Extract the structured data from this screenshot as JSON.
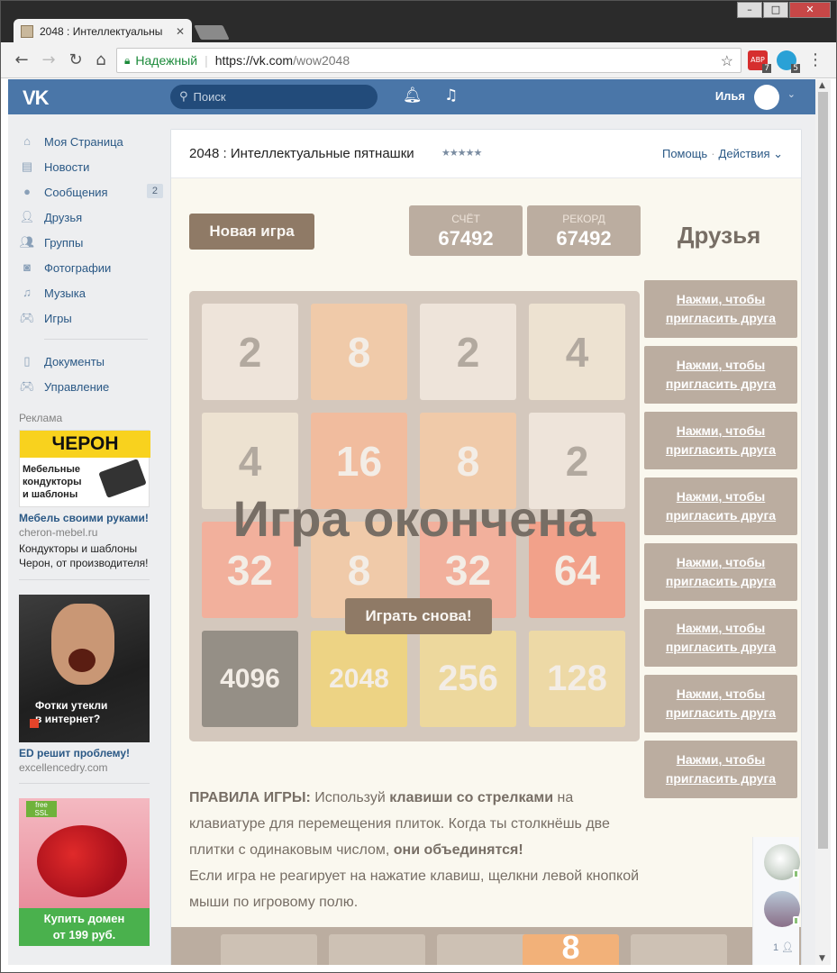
{
  "browser": {
    "tab_title": "2048 : Интеллектуальны",
    "tab_close": "✕",
    "secure_label": "Надежный",
    "url_host": "https://vk.com",
    "url_path": "/wow2048",
    "ext1_badge": "7",
    "ext2_badge": "5",
    "ext1_label": "ABP",
    "window_buttons": {
      "minimize": "–",
      "maximize": "□",
      "close": "✕"
    }
  },
  "vk": {
    "logo": "VK",
    "search_placeholder": "Поиск",
    "user_name": "Илья"
  },
  "nav": {
    "items": [
      {
        "label": "Моя Страница",
        "icon": "home-icon"
      },
      {
        "label": "Новости",
        "icon": "news-icon"
      },
      {
        "label": "Сообщения",
        "icon": "messages-icon",
        "count": "2"
      },
      {
        "label": "Друзья",
        "icon": "friends-icon"
      },
      {
        "label": "Группы",
        "icon": "groups-icon"
      },
      {
        "label": "Фотографии",
        "icon": "photos-icon"
      },
      {
        "label": "Музыка",
        "icon": "music-icon"
      },
      {
        "label": "Игры",
        "icon": "games-icon"
      }
    ],
    "items2": [
      {
        "label": "Документы",
        "icon": "documents-icon"
      },
      {
        "label": "Управление",
        "icon": "manage-icon"
      }
    ]
  },
  "ads": {
    "label": "Реклама",
    "ad1": {
      "banner_brand": "ЧЕРОН",
      "banner_text_1": "Мебельные",
      "banner_text_2": "кондукторы",
      "banner_text_3": "и шаблоны",
      "title": "Мебель своими руками!",
      "site": "cheron-mebel.ru",
      "desc": "Кондукторы и шаблоны Черон, от производителя!"
    },
    "ad2": {
      "caption_1": "Фотки утекли",
      "caption_2": "в интернет?",
      "title": "ED решит проблему!",
      "site": "excellencedry.com"
    },
    "ad3": {
      "ssl_label_1": "free",
      "ssl_label_2": "SSL",
      "cta_1": "Купить домен",
      "cta_2": "от 199 руб."
    }
  },
  "app": {
    "title": "2048 : Интеллектуальные пятнашки",
    "rating": "★★★★★",
    "help": "Помощь",
    "dot": "·",
    "actions": "Действия ⌄",
    "new_game": "Новая игра",
    "score_label": "СЧЁТ",
    "score": "67492",
    "best_label": "РЕКОРД",
    "best": "67492",
    "friends_title": "Друзья",
    "game_over": "Игра окончена",
    "retry": "Играть снова!",
    "invite_line1": "Нажми, чтобы",
    "invite_line2": "пригласить друга",
    "board": [
      [
        "2",
        "8",
        "2",
        "4"
      ],
      [
        "4",
        "16",
        "8",
        "2"
      ],
      [
        "32",
        "8",
        "32",
        "64"
      ],
      [
        "4096",
        "2048",
        "256",
        "128"
      ]
    ],
    "rules": {
      "heading": "ПРАВИЛА ИГРЫ:",
      "t1": " Используй ",
      "b1": "клавиши со стрелками",
      "t2": " на клавиатуре для перемещения плиток. Когда ты столкнёшь две плитки с одинаковым числом, ",
      "b2": "они объединятся!",
      "t3": "Если игра не реагирует на нажатие клавиш, щелкни левой кнопкой мыши по игровому полю."
    },
    "bottom_tile": "8"
  },
  "mini_friends": {
    "count": "1"
  },
  "colors": {
    "vk_blue": "#4a76a8",
    "tile_2": "#eee4da",
    "tile_4": "#ede0c8",
    "tile_8": "#f2b179",
    "tile_16": "#f59563",
    "tile_32": "#f67c5f",
    "tile_64": "#f65e3b",
    "tile_128": "#edcf72",
    "tile_256": "#edcc61",
    "tile_2048": "#edc22e",
    "tile_super": "#3c3a32"
  }
}
